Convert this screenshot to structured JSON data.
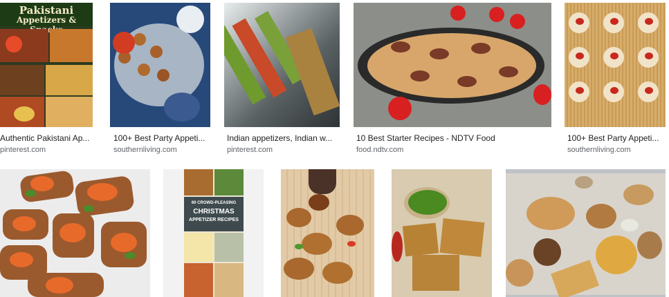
{
  "results": [
    {
      "caption": "Authentic Pakistani Ap...",
      "source": "pinterest.com",
      "overlay": "Pakistani",
      "overlay2": "Appetizers & Snacks"
    },
    {
      "caption": "100+ Best Party Appeti...",
      "source": "southernliving.com"
    },
    {
      "caption": "Indian appetizers, Indian w...",
      "source": "pinterest.com"
    },
    {
      "caption": "10 Best Starter Recipes - NDTV Food",
      "source": "food.ndtv.com"
    },
    {
      "caption": "100+ Best Party Appeti...",
      "source": "southernliving.com"
    },
    {
      "caption": ""
    },
    {
      "caption": "",
      "overlay": "60 CROWD-PLEASING",
      "overlay2": "CHRISTMAS",
      "overlay3": "APPETIZER RECIPES"
    },
    {
      "caption": ""
    },
    {
      "caption": ""
    },
    {
      "caption": ""
    }
  ],
  "colors": {
    "caption": "#202124",
    "source": "#5f6368"
  }
}
